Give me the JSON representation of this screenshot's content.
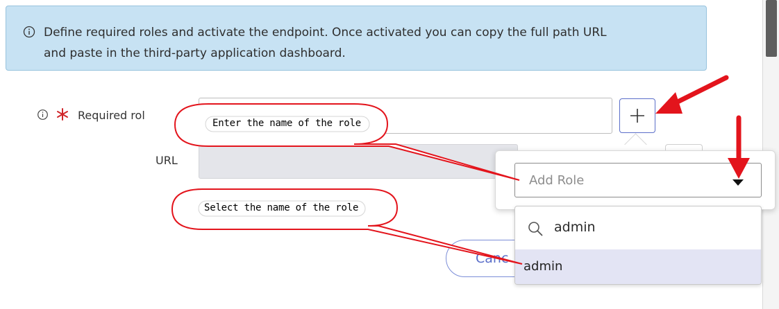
{
  "banner": {
    "icon": "info-icon",
    "text_line1": "Define required roles and activate the endpoint. Once activated you can copy the full path URL",
    "text_line2": "and paste in the third-party application dashboard."
  },
  "form": {
    "required_roles_label": "Required rol",
    "url_label": "URL"
  },
  "popover": {
    "add_role_placeholder": "Add Role",
    "search_value": "admin",
    "options": [
      "admin"
    ]
  },
  "footer": {
    "cancel_label": "Canc"
  },
  "annotations": {
    "callout_1": "Enter the name of the role",
    "callout_2": "Select the name of the role"
  },
  "colors": {
    "banner_bg": "#c7e2f3",
    "banner_border": "#98c3de",
    "required_star": "#d0262a",
    "accent": "#5a6ec9",
    "annotation_red": "#e3141c",
    "option_highlight": "#e3e4f4"
  }
}
